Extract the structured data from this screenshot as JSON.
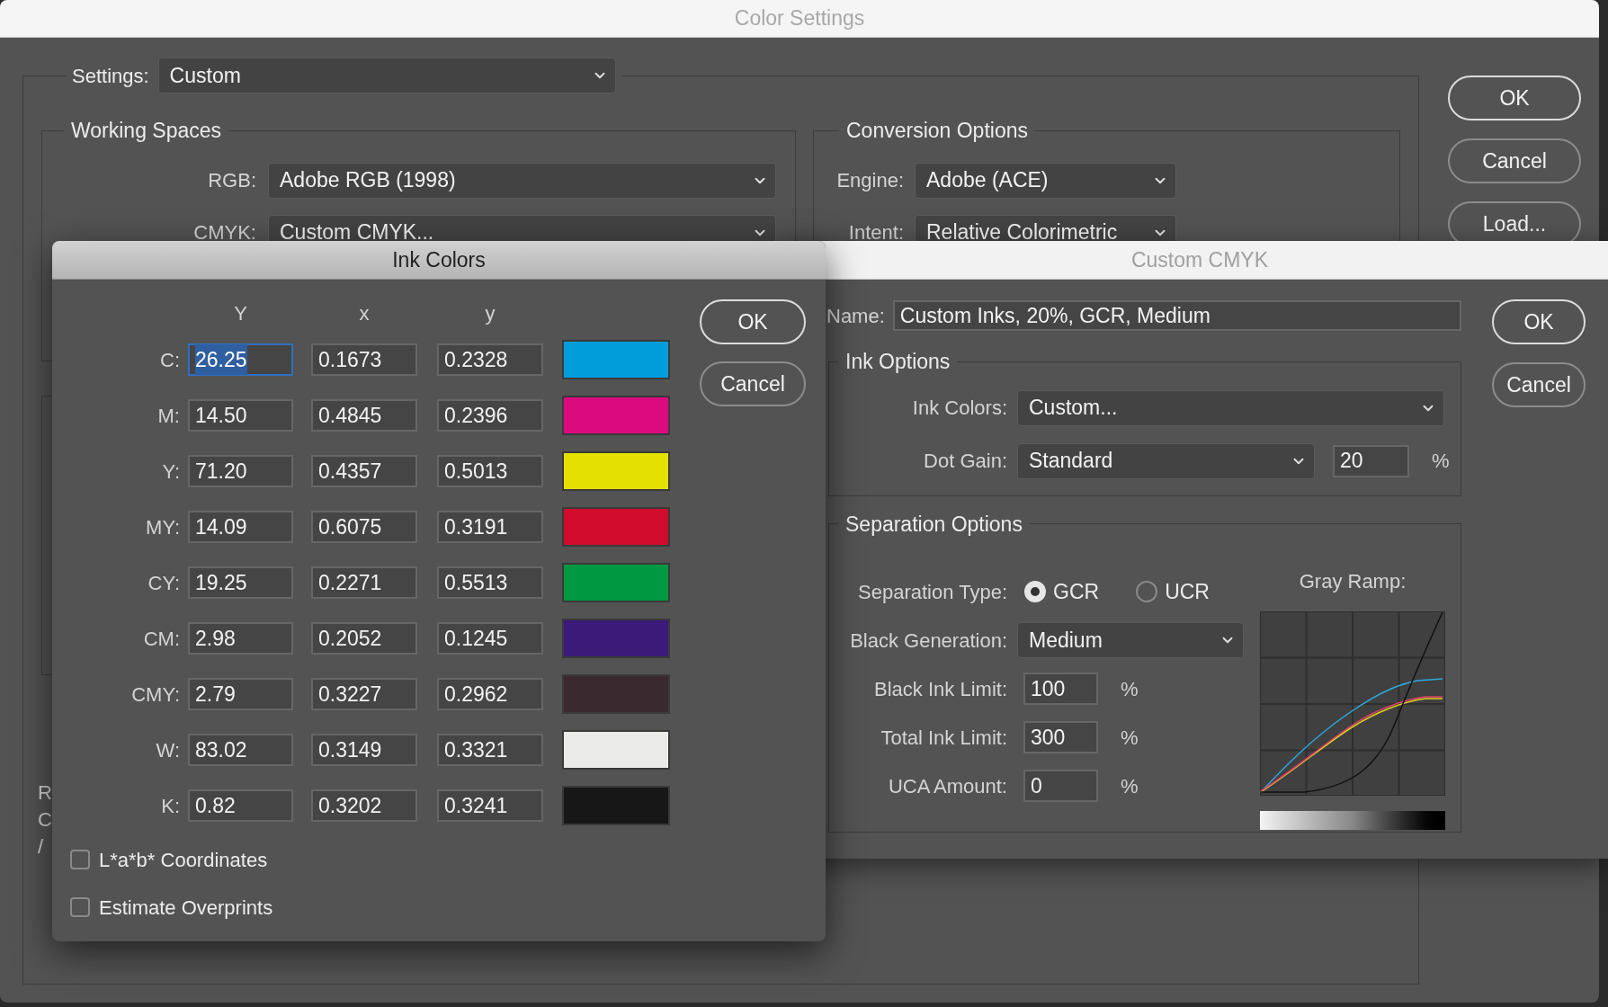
{
  "color_settings": {
    "title": "Color Settings",
    "settings": {
      "label": "Settings:",
      "value": "Custom"
    },
    "working_spaces": {
      "title": "Working Spaces",
      "fields": [
        {
          "label": "RGB:",
          "value": "Adobe RGB (1998)"
        },
        {
          "label": "CMYK:",
          "value": "Custom CMYK..."
        }
      ]
    },
    "conversion_options": {
      "title": "Conversion Options",
      "fields": [
        {
          "label": "Engine:",
          "value": "Adobe (ACE)"
        },
        {
          "label": "Intent:",
          "value": "Relative Colorimetric"
        }
      ]
    },
    "partial_text": [
      "R",
      "C",
      "/"
    ],
    "buttons": [
      "OK",
      "Cancel",
      "Load..."
    ]
  },
  "ink_colors": {
    "title": "Ink Colors",
    "columns": [
      "Y",
      "x",
      "y"
    ],
    "rows": [
      {
        "label": "C:",
        "values": [
          "26.25",
          "0.1673",
          "0.2328"
        ],
        "color": "#009ddb",
        "selected": true
      },
      {
        "label": "M:",
        "values": [
          "14.50",
          "0.4845",
          "0.2396"
        ],
        "color": "#dc0a7f",
        "selected": false
      },
      {
        "label": "Y:",
        "values": [
          "71.20",
          "0.4357",
          "0.5013"
        ],
        "color": "#e4e000",
        "selected": false
      },
      {
        "label": "MY:",
        "values": [
          "14.09",
          "0.6075",
          "0.3191"
        ],
        "color": "#d20c2c",
        "selected": false
      },
      {
        "label": "CY:",
        "values": [
          "19.25",
          "0.2271",
          "0.5513"
        ],
        "color": "#009840",
        "selected": false
      },
      {
        "label": "CM:",
        "values": [
          "2.98",
          "0.2052",
          "0.1245"
        ],
        "color": "#3b1a7a",
        "selected": false
      },
      {
        "label": "CMY:",
        "values": [
          "2.79",
          "0.3227",
          "0.2962"
        ],
        "color": "#3a2a30",
        "selected": false
      },
      {
        "label": "W:",
        "values": [
          "83.02",
          "0.3149",
          "0.3321"
        ],
        "color": "#ebebe9",
        "selected": false
      },
      {
        "label": "K:",
        "values": [
          "0.82",
          "0.3202",
          "0.3241"
        ],
        "color": "#171717",
        "selected": false
      }
    ],
    "checkboxes": [
      {
        "label": "L*a*b* Coordinates",
        "checked": false
      },
      {
        "label": "Estimate Overprints",
        "checked": false
      }
    ],
    "buttons": [
      "OK",
      "Cancel"
    ]
  },
  "custom_cmyk": {
    "title": "Custom CMYK",
    "name": {
      "label": "Name:",
      "value": "Custom Inks, 20%, GCR, Medium"
    },
    "ink_options": {
      "title": "Ink Options",
      "ink_colors": {
        "label": "Ink Colors:",
        "value": "Custom..."
      },
      "dot_gain": {
        "label": "Dot Gain:",
        "value": "Standard",
        "amount": "20",
        "unit": "%"
      }
    },
    "separation_options": {
      "title": "Separation Options",
      "separation_type": {
        "label": "Separation Type:",
        "options": [
          {
            "label": "GCR",
            "selected": true
          },
          {
            "label": "UCR",
            "selected": false
          }
        ]
      },
      "black_generation": {
        "label": "Black Generation:",
        "value": "Medium"
      },
      "limits": [
        {
          "label": "Black Ink Limit:",
          "value": "100",
          "unit": "%"
        },
        {
          "label": "Total Ink Limit:",
          "value": "300",
          "unit": "%"
        },
        {
          "label": "UCA Amount:",
          "value": "0",
          "unit": "%"
        }
      ],
      "gray_ramp": {
        "label": "Gray Ramp:"
      }
    },
    "buttons": [
      "OK",
      "Cancel"
    ]
  }
}
